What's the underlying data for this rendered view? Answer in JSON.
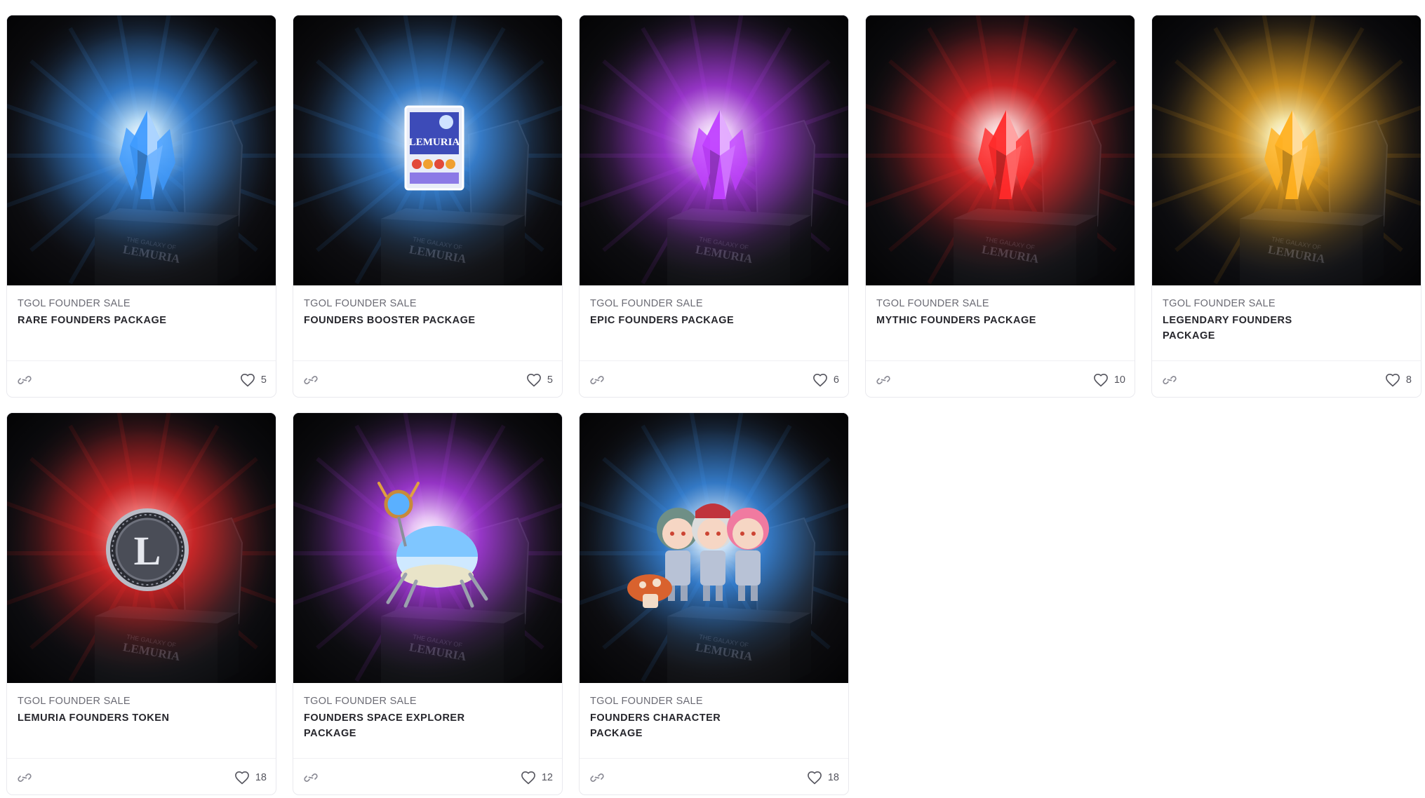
{
  "cards": [
    {
      "collection": "TGOL FOUNDER SALE",
      "title": "RARE FOUNDERS PACKAGE",
      "likes": "5",
      "art": "crystal",
      "glow": "#3f9bff",
      "core": "#bfe4ff"
    },
    {
      "collection": "TGOL FOUNDER SALE",
      "title": "FOUNDERS BOOSTER PACKAGE",
      "likes": "5",
      "art": "booster",
      "glow": "#3f9bff",
      "core": "#cfe8ff"
    },
    {
      "collection": "TGOL FOUNDER SALE",
      "title": "EPIC FOUNDERS PACKAGE",
      "likes": "6",
      "art": "crystal",
      "glow": "#c040ff",
      "core": "#f0c8ff"
    },
    {
      "collection": "TGOL FOUNDER SALE",
      "title": "MYTHIC FOUNDERS PACKAGE",
      "likes": "10",
      "art": "crystal",
      "glow": "#ff2a2a",
      "core": "#ffc8c8"
    },
    {
      "collection": "TGOL FOUNDER SALE",
      "title": "LEGENDARY FOUNDERS PACKAGE",
      "likes": "8",
      "art": "crystal",
      "glow": "#ffb020",
      "core": "#fff0b0"
    },
    {
      "collection": "TGOL FOUNDER SALE",
      "title": "LEMURIA FOUNDERS TOKEN",
      "likes": "18",
      "art": "token",
      "glow": "#ff2a2a",
      "core": "#ff9090"
    },
    {
      "collection": "TGOL FOUNDER SALE",
      "title": "FOUNDERS SPACE EXPLORER PACKAGE",
      "likes": "12",
      "art": "explorer",
      "glow": "#c040ff",
      "core": "#f0c8ff"
    },
    {
      "collection": "TGOL FOUNDER SALE",
      "title": "FOUNDERS CHARACTER PACKAGE",
      "likes": "18",
      "art": "characters",
      "glow": "#3f9bff",
      "core": "#cfe8ff"
    }
  ],
  "chest_engraving": [
    "THE GALAXY OF",
    "LEMURIA"
  ],
  "booster_label": "LEMURIA",
  "token_letter": "L",
  "icons": {
    "link": "link-icon",
    "like": "heart-icon"
  },
  "colors": {
    "card_bg": "#ffffff",
    "media_bg": "#0f0f13",
    "collection_text": "#6b6b74",
    "title_text": "#26262c"
  }
}
